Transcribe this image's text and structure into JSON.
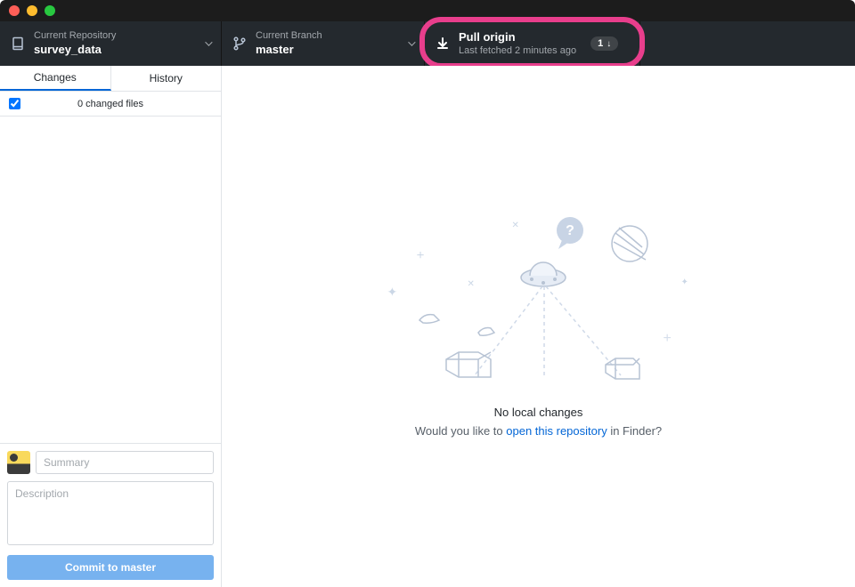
{
  "toolbar": {
    "repo": {
      "label": "Current Repository",
      "value": "survey_data"
    },
    "branch": {
      "label": "Current Branch",
      "value": "master"
    },
    "pull": {
      "label": "Pull origin",
      "sub": "Last fetched 2 minutes ago",
      "badge_count": "1"
    }
  },
  "tabs": {
    "changes": "Changes",
    "history": "History"
  },
  "changes": {
    "count_label": "0 changed files"
  },
  "commit": {
    "summary_placeholder": "Summary",
    "description_placeholder": "Description",
    "button_prefix": "Commit to ",
    "button_branch": "master"
  },
  "empty_state": {
    "title": "No local changes",
    "sub_prefix": "Would you like to ",
    "link": "open this repository",
    "sub_suffix": " in Finder?"
  }
}
